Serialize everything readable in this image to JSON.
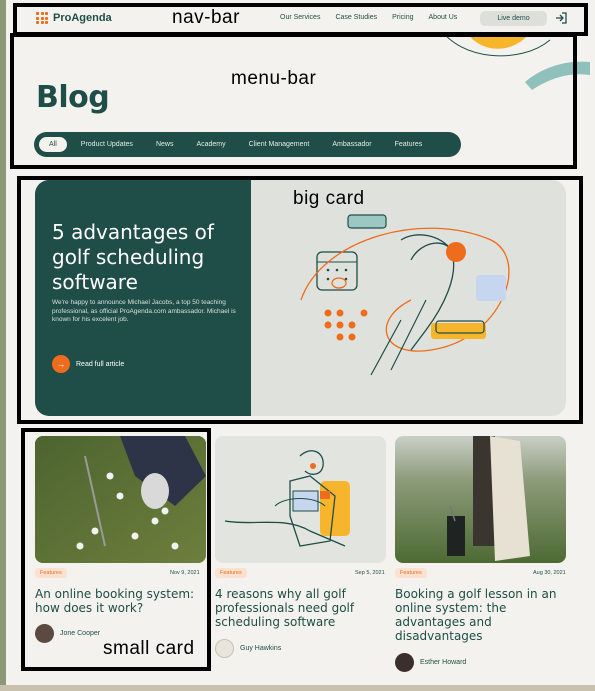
{
  "nav": {
    "logo": "ProAgenda",
    "links": [
      "Our Services",
      "Case Studies",
      "Pricing",
      "About Us"
    ],
    "live_demo": "Live demo",
    "login_icon": "login-arrow-icon"
  },
  "menu": {
    "title": "Blog",
    "tabs": [
      "All",
      "Product Updates",
      "News",
      "Academy",
      "Client Management",
      "Ambassador",
      "Features"
    ],
    "active_tab": "All"
  },
  "featured": {
    "title": "5 advantages of golf scheduling software",
    "description": "We're happy to announce Michael Jacobs, a top 50 teaching professional, as official ProAgenda.com ambassador. Michael is known for his excelent job.",
    "cta": "Read full article"
  },
  "cards": [
    {
      "badge": "Features",
      "date": "Nov 9, 2021",
      "title": "An online booking system: how does it work?",
      "author": "Jone Cooper"
    },
    {
      "badge": "Features",
      "date": "Sep 5, 2021",
      "title": "4 reasons why all golf professionals need golf scheduling software",
      "author": "Guy Hawkins"
    },
    {
      "badge": "Features",
      "date": "Aug 30, 2021",
      "title": "Booking a golf lesson in an online system: the advantages and disadvantages",
      "author": "Esther Howard"
    }
  ],
  "annotations": {
    "nav_bar": "nav-bar",
    "menu_bar": "menu-bar",
    "big_card": "big card",
    "small_card": "small card"
  },
  "colors": {
    "brand_dark": "#1f4d47",
    "accent": "#ef6c1c",
    "background": "#f4f2ee"
  }
}
